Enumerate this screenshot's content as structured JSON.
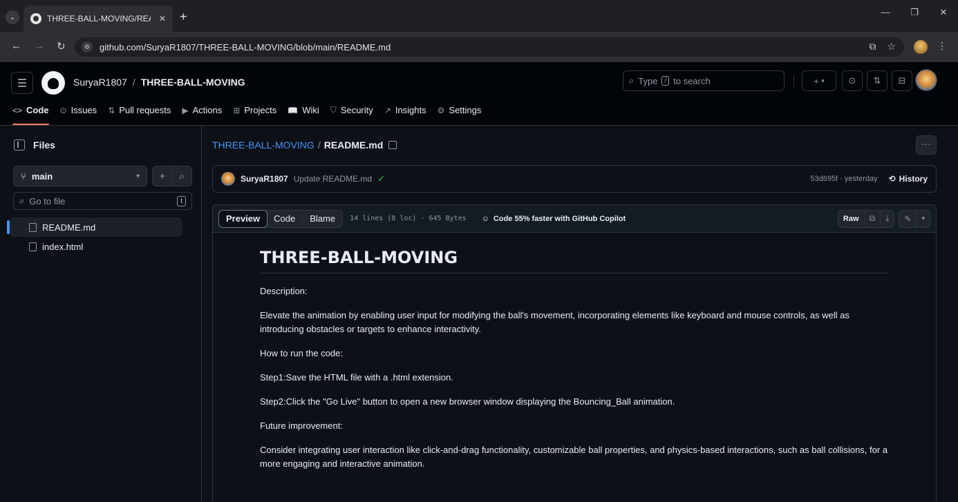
{
  "browser": {
    "tab_title": "THREE-BALL-MOVING/READMI",
    "url": "github.com/SuryaR1807/THREE-BALL-MOVING/blob/main/README.md"
  },
  "header": {
    "owner": "SuryaR1807",
    "separator": "/",
    "repo": "THREE-BALL-MOVING",
    "search_prefix": "Type",
    "search_key": "/",
    "search_suffix": "to search"
  },
  "repo_nav": [
    {
      "icon": "<>",
      "label": "Code"
    },
    {
      "icon": "⊙",
      "label": "Issues"
    },
    {
      "icon": "⇅",
      "label": "Pull requests"
    },
    {
      "icon": "▶",
      "label": "Actions"
    },
    {
      "icon": "⊞",
      "label": "Projects"
    },
    {
      "icon": "📖",
      "label": "Wiki"
    },
    {
      "icon": "⛉",
      "label": "Security"
    },
    {
      "icon": "↗",
      "label": "Insights"
    },
    {
      "icon": "⚙",
      "label": "Settings"
    }
  ],
  "sidebar": {
    "title": "Files",
    "branch": "main",
    "goto_placeholder": "Go to file",
    "goto_key": "t",
    "files": [
      "README.md",
      "index.html"
    ]
  },
  "file": {
    "repo_link": "THREE-BALL-MOVING",
    "separator": "/",
    "name": "README.md",
    "commit_author": "SuryaR1807",
    "commit_message": "Update README.md",
    "commit_meta": "53d695f · yesterday",
    "history_label": "History",
    "tab_preview": "Preview",
    "tab_code": "Code",
    "tab_blame": "Blame",
    "stats": "14 lines (8 loc) · 645 Bytes",
    "copilot": "Code 55% faster with GitHub Copilot",
    "raw_label": "Raw"
  },
  "readme": {
    "heading": "THREE-BALL-MOVING",
    "paragraphs": [
      "Description:",
      "Elevate the animation by enabling user input for modifying the ball's movement, incorporating elements like keyboard and mouse controls, as well as introducing obstacles or targets to enhance interactivity.",
      "How to run the code:",
      "Step1:Save the HTML file with a .html extension.",
      "Step2:Click the \"Go Live\" button to open a new browser window displaying the Bouncing_Ball animation.",
      "Future improvement:",
      "Consider integrating user interaction like click-and-drag functionality, customizable ball properties, and physics-based interactions, such as ball collisions, for a more engaging and interactive animation."
    ]
  }
}
